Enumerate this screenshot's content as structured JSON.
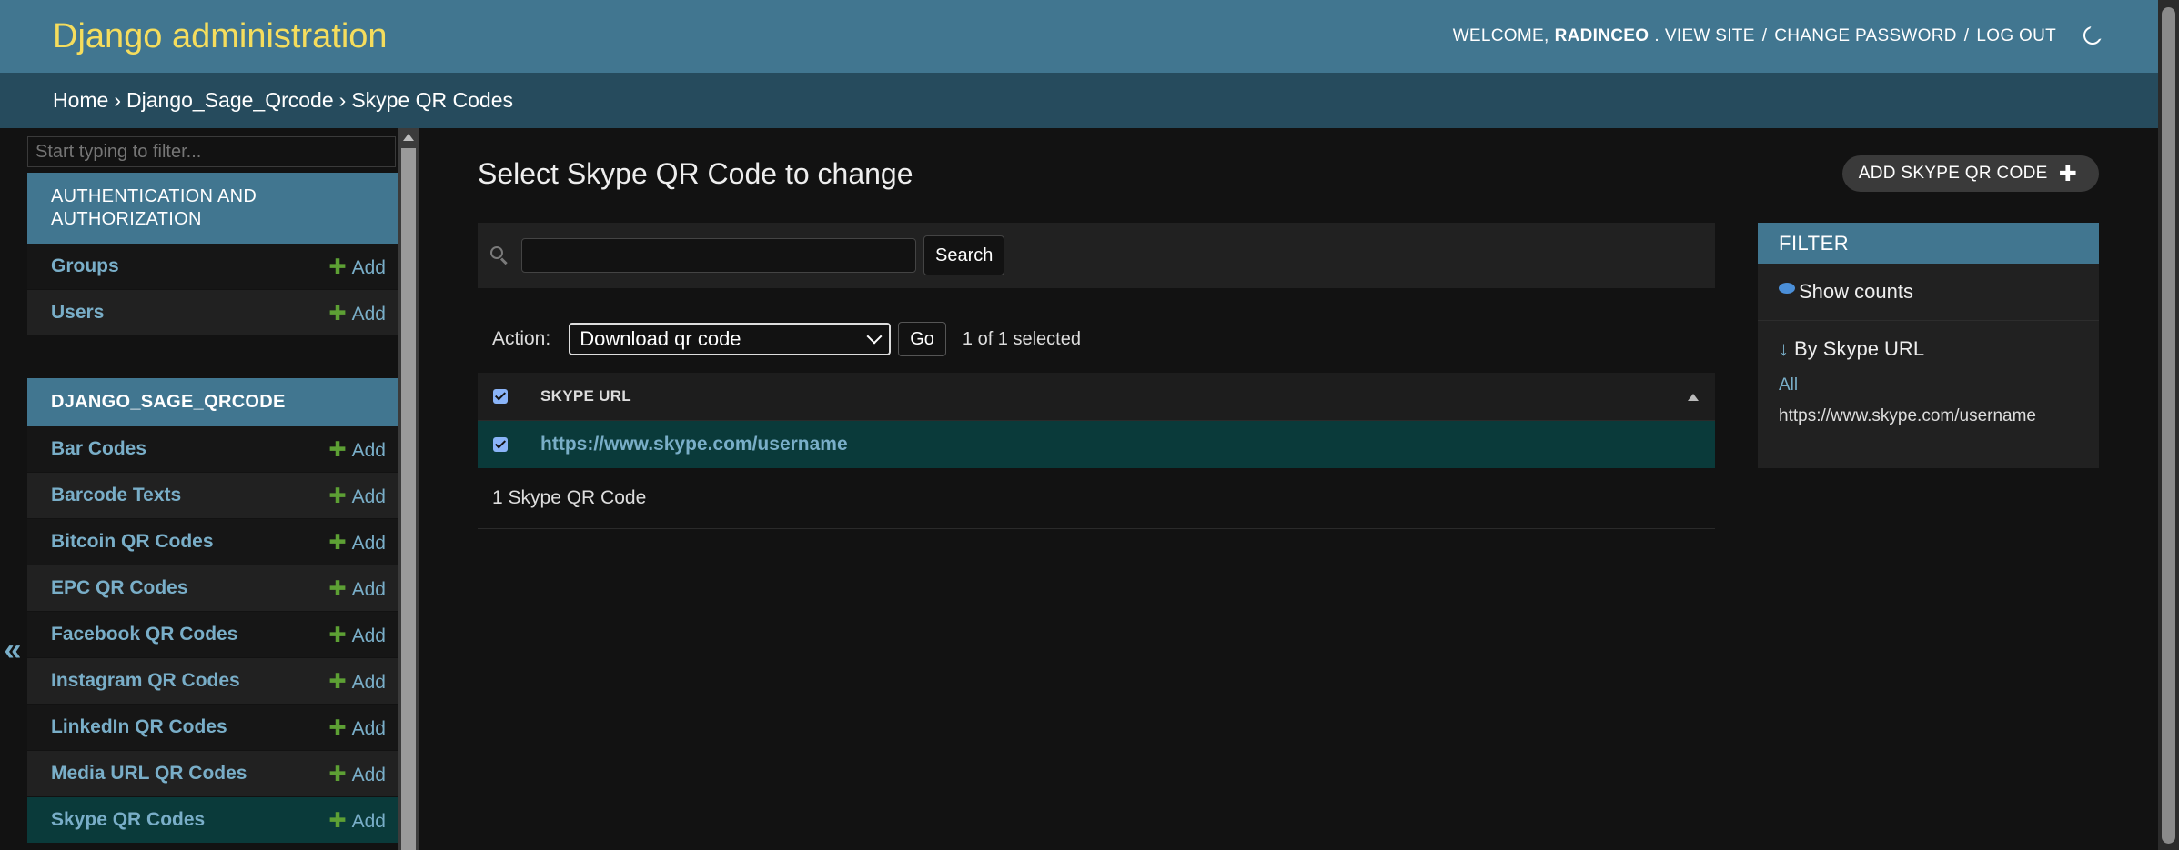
{
  "header": {
    "brand": "Django administration",
    "welcome": "WELCOME,",
    "username": "RADINCEO",
    "view_site": "VIEW SITE",
    "change_password": "CHANGE PASSWORD",
    "log_out": "LOG OUT",
    "separator": "/",
    "theme_icon": "moon-icon"
  },
  "breadcrumbs": [
    "Home",
    "›",
    "Django_Sage_Qrcode",
    "›",
    "Skype QR Codes"
  ],
  "sidebar": {
    "filter_placeholder": "Start typing to filter...",
    "collapse_glyph": "«",
    "modules": [
      {
        "caption": "AUTHENTICATION AND AUTHORIZATION",
        "models": [
          {
            "name": "Groups",
            "add": "Add"
          },
          {
            "name": "Users",
            "add": "Add"
          }
        ]
      },
      {
        "caption": "DJANGO_SAGE_QRCODE",
        "models": [
          {
            "name": "Bar Codes",
            "add": "Add"
          },
          {
            "name": "Barcode Texts",
            "add": "Add"
          },
          {
            "name": "Bitcoin QR Codes",
            "add": "Add"
          },
          {
            "name": "EPC QR Codes",
            "add": "Add"
          },
          {
            "name": "Facebook QR Codes",
            "add": "Add"
          },
          {
            "name": "Instagram QR Codes",
            "add": "Add"
          },
          {
            "name": "LinkedIn QR Codes",
            "add": "Add"
          },
          {
            "name": "Media URL QR Codes",
            "add": "Add"
          },
          {
            "name": "Skype QR Codes",
            "add": "Add"
          }
        ]
      }
    ]
  },
  "content": {
    "title": "Select Skype QR Code to change",
    "add_button": "ADD SKYPE QR CODE",
    "search_button": "Search",
    "action_label": "Action:",
    "action_selected": "Download qr code",
    "go_button": "Go",
    "selected_count": "1 of 1 selected",
    "table": {
      "column": "SKYPE URL",
      "rows": [
        "https://www.skype.com/username"
      ]
    },
    "paginator": "1 Skype QR Code"
  },
  "filter": {
    "title": "FILTER",
    "show_counts": "Show counts",
    "by_title": "By Skype URL",
    "arrow": "↓",
    "options": [
      "All",
      "https://www.skype.com/username"
    ]
  },
  "colors": {
    "header": "#417690",
    "breadcrumbs": "#264b5d",
    "brand": "#f5dd5d",
    "link": "#79aec8",
    "add_plus": "#5da034",
    "selected_row": "#0a3a3a"
  }
}
